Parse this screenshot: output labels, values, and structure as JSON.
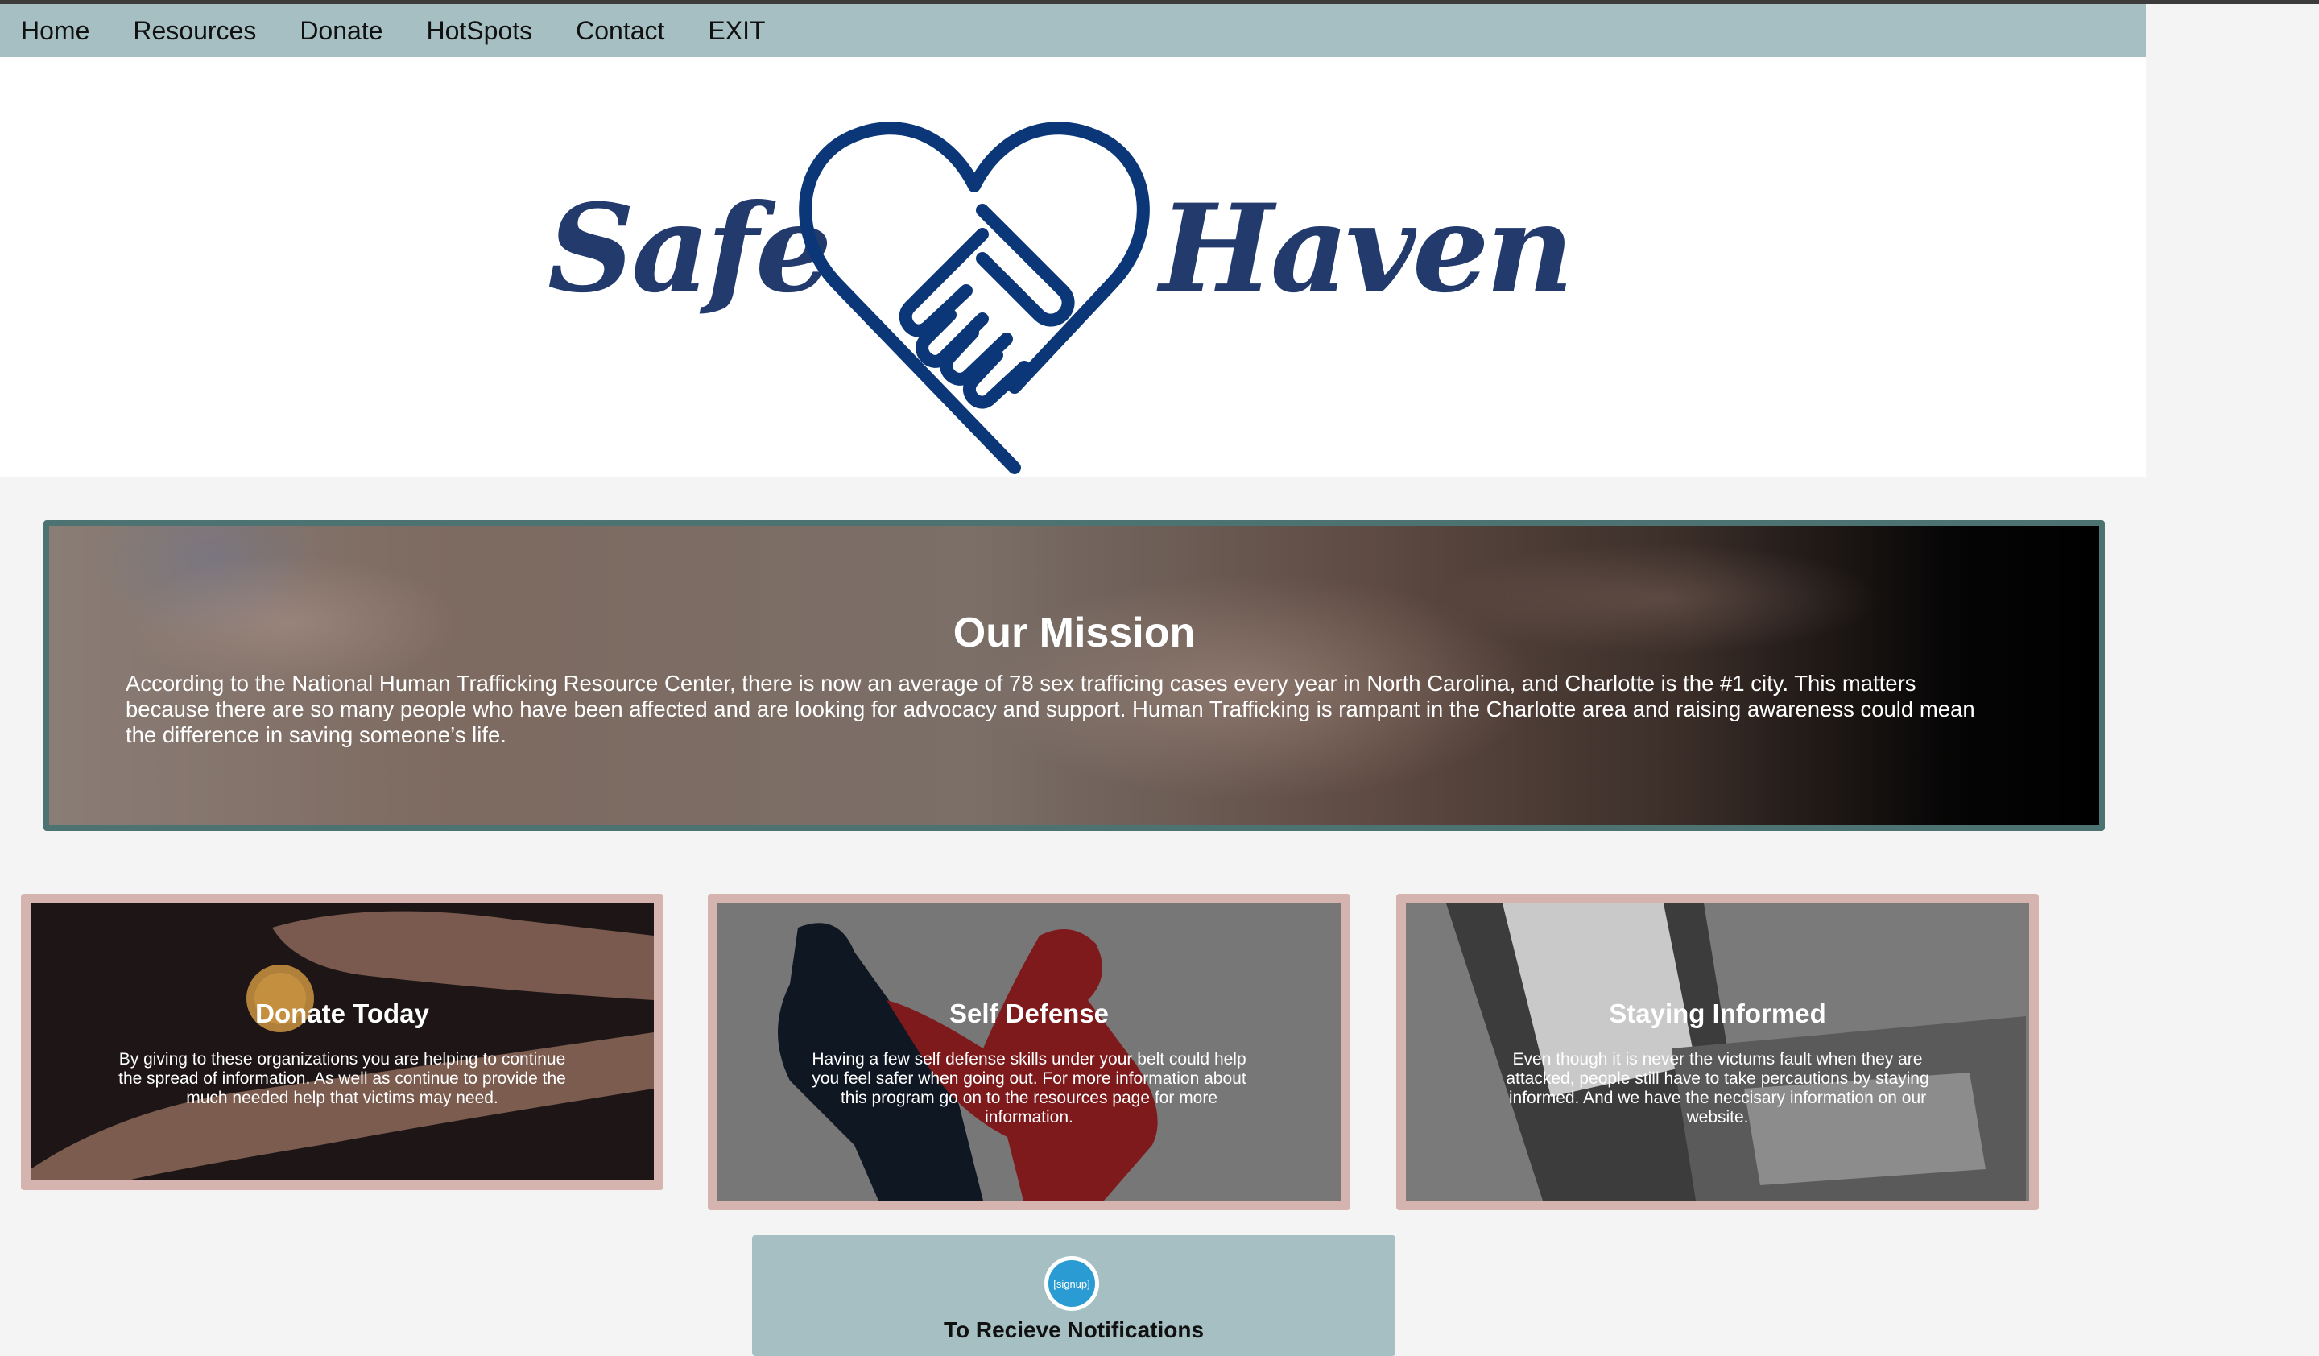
{
  "nav": {
    "items": [
      "Home",
      "Resources",
      "Donate",
      "HotSpots",
      "Contact",
      "EXIT"
    ]
  },
  "logo": {
    "left_word": "Safe",
    "right_word": "Haven",
    "color": "#233a6d"
  },
  "mission": {
    "title": "Our Mission",
    "text": "According to the National Human Trafficking Resource Center, there is now an average of 78 sex trafficing cases every year in North Carolina, and Charlotte is the #1 city. This matters because there are so many people who have been affected and are looking for advocacy and support. Human Trafficking is rampant in the Charlotte area and raising awareness could mean the difference in saving someone’s life."
  },
  "cards": [
    {
      "title": "Donate Today",
      "text": "By giving to these organizations you are helping to continue the spread of information. As well as continue to provide the much needed help that victims may need."
    },
    {
      "title": "Self Defense",
      "text": "Having a few self defense skills under your belt could help you feel safer when going out. For more information about this program go on to the resources page for more information."
    },
    {
      "title": "Staying Informed",
      "text": "Even though it is never the victums fault when they are attacked, people still have to take percautions by staying informed. And we have the neccisary information on our website."
    }
  ],
  "signup": {
    "badge": "[signup]",
    "heading": "To Recieve Notifications"
  },
  "colors": {
    "nav_bg": "#a6bfc2",
    "mission_border": "#4c7371",
    "card_border": "#d5b3ae",
    "page_bg": "#f4f4f4"
  }
}
